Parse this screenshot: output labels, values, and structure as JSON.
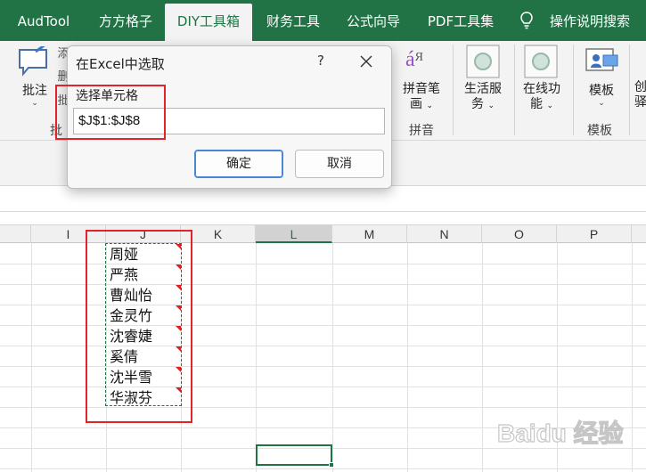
{
  "ribbon_tabs": [
    {
      "label": "AudTool",
      "active": false
    },
    {
      "label": "方方格子",
      "active": false
    },
    {
      "label": "DIY工具箱",
      "active": true
    },
    {
      "label": "财务工具",
      "active": false
    },
    {
      "label": "公式向导",
      "active": false
    },
    {
      "label": "PDF工具集",
      "active": false
    },
    {
      "label": "操作说明搜索",
      "active": false
    }
  ],
  "ribbon": {
    "comment_label": "批注",
    "comment_group_partial": "批",
    "partial_1": "添",
    "partial_2": "删",
    "partial_3": "批",
    "pinyin_pen_label_1": "拼音笔",
    "pinyin_pen_label_2": "画",
    "pinyin_group": "拼音",
    "life_service_label_1": "生活服",
    "life_service_label_2": "务",
    "online_label_1": "在线功",
    "online_label_2": "能",
    "template_label": "模板",
    "template_group": "模板",
    "partial_right_1": "创",
    "partial_right_2": "驿"
  },
  "dialog": {
    "title": "在Excel中选取",
    "help": "?",
    "field_label": "选择单元格",
    "field_value": "$J$1:$J$8",
    "ok_label": "确定",
    "cancel_label": "取消"
  },
  "grid": {
    "columns": [
      "I",
      "J",
      "K",
      "L",
      "M",
      "N",
      "O",
      "P"
    ],
    "selected_column": "L",
    "cells": [
      "周娅",
      "严燕",
      "曹灿怡",
      "金灵竹",
      "沈睿婕",
      "奚倩",
      "沈半雪",
      "华淑芬"
    ]
  },
  "watermark_text": "Baidu 经验",
  "colors": {
    "excel_green": "#217346",
    "highlight_red": "#e0242a",
    "ribbon_bg": "#f3f3f3"
  }
}
